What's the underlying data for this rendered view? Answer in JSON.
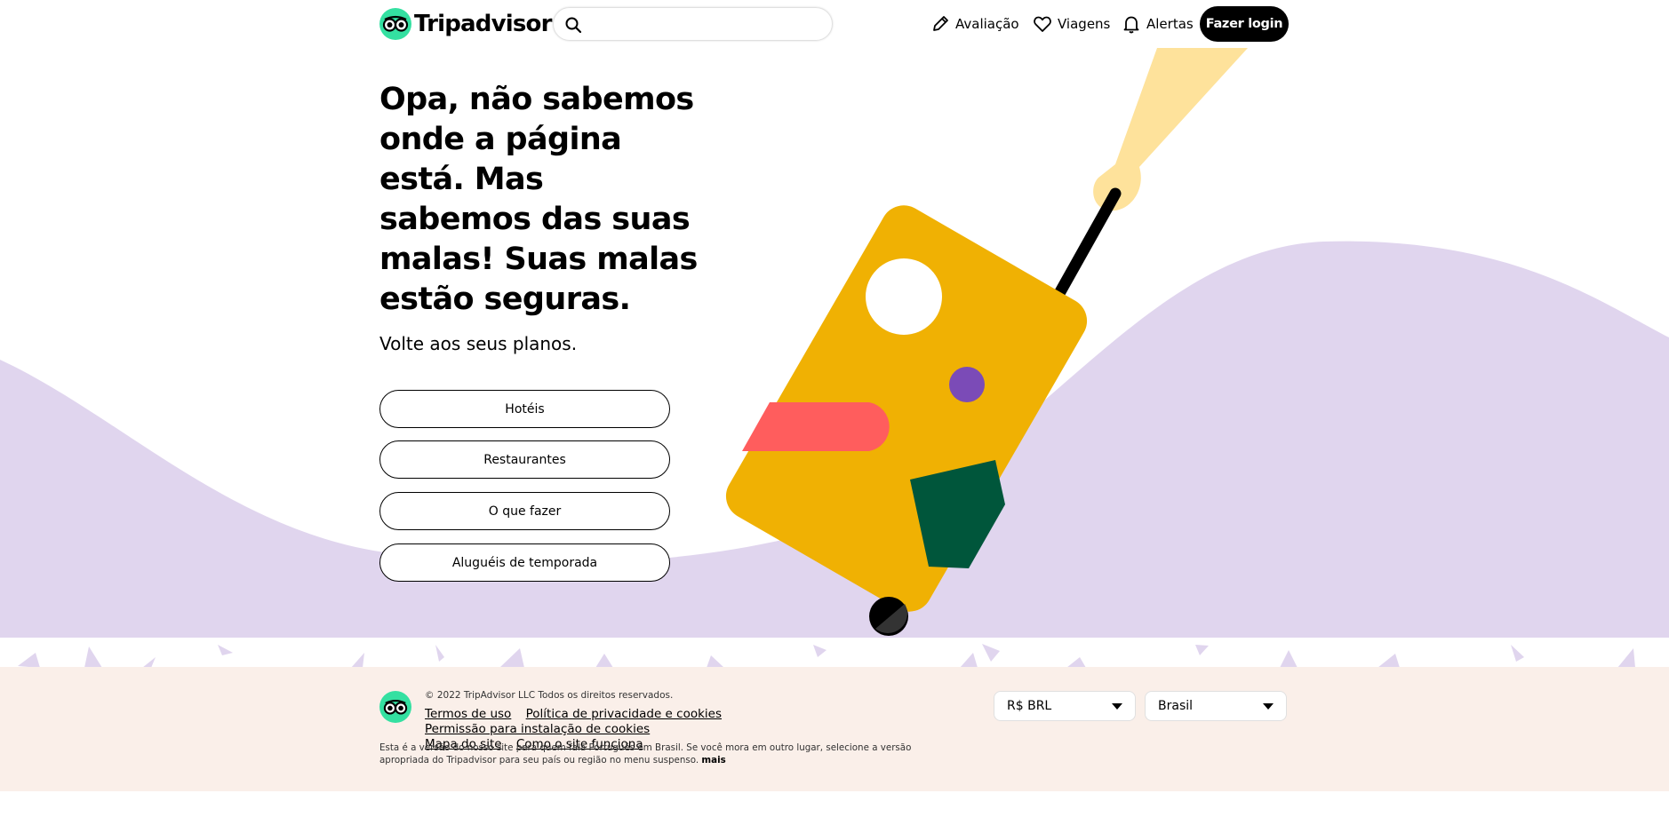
{
  "header": {
    "logo_text": "Tripadvisor",
    "search_placeholder": "",
    "nav": {
      "review_label": "Avaliação",
      "trips_label": "Viagens",
      "alerts_label": "Alertas"
    },
    "login_label": "Fazer login"
  },
  "hero": {
    "title": "Opa, não sabemos onde a página está. Mas sabemos das suas malas! Suas malas estão seguras.",
    "subtitle": "Volte aos seus planos.",
    "buttons": [
      {
        "label": "Hotéis"
      },
      {
        "label": "Restaurantes"
      },
      {
        "label": "O que fazer"
      },
      {
        "label": "Aluguéis de temporada"
      }
    ]
  },
  "footer": {
    "copyright": "© 2022 TripAdvisor LLC Todos os direitos reservados.",
    "links": [
      {
        "label": "Termos de uso"
      },
      {
        "label": "Política de privacidade e cookies"
      },
      {
        "label": "Permissão para instalação de cookies"
      },
      {
        "label": "Mapa do site"
      },
      {
        "label": "Como o site funciona"
      }
    ],
    "disclaimer": "Esta é a versão do nosso site para quem fala Português em Brasil. Se você mora em outro lugar, selecione a versão apropriada do Tripadvisor para seu país ou região no menu suspenso.",
    "more_label": "mais",
    "currency_value": "R$ BRL",
    "country_value": "Brasil"
  },
  "colors": {
    "brand_green": "#34e0a1",
    "hill_lavender": "#e0d5ee",
    "suitcase_yellow": "#f0b103",
    "footer_bg": "#faefe9"
  }
}
